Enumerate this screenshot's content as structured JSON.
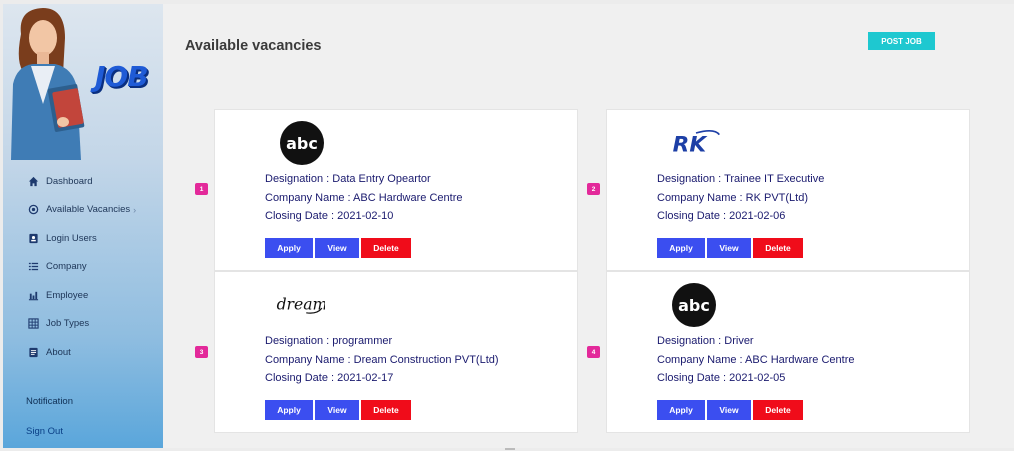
{
  "brand": {
    "logo_text": "JOB"
  },
  "sidebar": {
    "items": [
      {
        "label": "Dashboard",
        "icon": "home-icon"
      },
      {
        "label": "Available Vacancies",
        "icon": "target-icon",
        "has_submenu": true
      },
      {
        "label": "Login Users",
        "icon": "user-card-icon"
      },
      {
        "label": "Company",
        "icon": "list-icon"
      },
      {
        "label": "Employee",
        "icon": "bar-chart-icon"
      },
      {
        "label": "Job Types",
        "icon": "grid-icon"
      },
      {
        "label": "About",
        "icon": "document-icon"
      }
    ],
    "notification": "Notification",
    "signout": "Sign Out"
  },
  "main": {
    "title": "Available vacancies",
    "post_job": "POST JOB",
    "buttons": {
      "apply": "Apply",
      "view": "View",
      "delete": "Delete"
    },
    "colors": {
      "accent": "#1ec8d0",
      "primary": "#3b4ef0",
      "danger": "#f00c1a",
      "badge": "#e3299a"
    },
    "vacancies": [
      {
        "index": "1",
        "logo": "abc-logo",
        "designation": "Designation : Data Entry Opeartor",
        "company": "Company Name : ABC Hardware Centre",
        "closing": "Closing Date : 2021-02-10"
      },
      {
        "index": "2",
        "logo": "rk-logo",
        "designation": "Designation : Trainee IT Executive",
        "company": "Company Name : RK PVT(Ltd)",
        "closing": "Closing Date : 2021-02-06"
      },
      {
        "index": "3",
        "logo": "dream-logo",
        "designation": "Designation : programmer",
        "company": "Company Name : Dream Construction PVT(Ltd)",
        "closing": "Closing Date : 2021-02-17"
      },
      {
        "index": "4",
        "logo": "abc-logo",
        "designation": "Designation : Driver",
        "company": "Company Name : ABC Hardware Centre",
        "closing": "Closing Date : 2021-02-05"
      }
    ]
  }
}
